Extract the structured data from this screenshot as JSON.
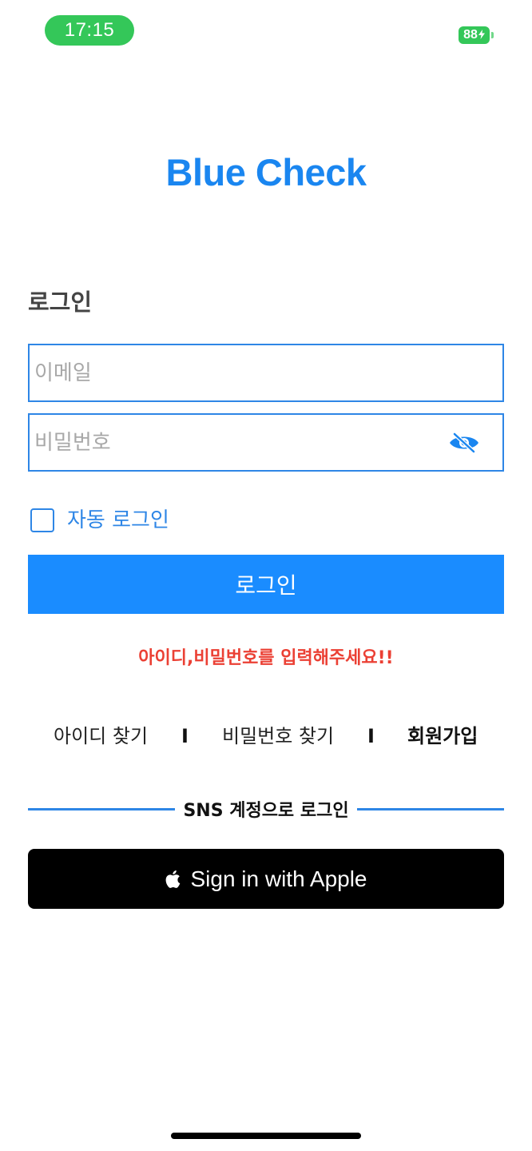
{
  "status_bar": {
    "time": "17:15",
    "battery_level": "88",
    "battery_charging": true,
    "accent_color": "#34c759"
  },
  "brand": {
    "name": "Blue Check",
    "color": "#1a86f0"
  },
  "login": {
    "title": "로그인",
    "email_placeholder": "이메일",
    "password_placeholder": "비밀번호",
    "password_toggle_icon": "eye-slash-icon",
    "auto_login_label": "자동 로그인",
    "auto_login_checked": false,
    "submit_label": "로그인",
    "error_message": "아이디,비밀번호를 입력해주세요!!",
    "error_color": "#eb4034"
  },
  "links": {
    "find_id": "아이디 찾기",
    "separator": "I",
    "find_password": "비밀번호 찾기",
    "signup": "회원가입"
  },
  "sns": {
    "divider_label": "SNS 계정으로 로그인",
    "apple_label": "Sign in with Apple",
    "apple_icon": "apple-logo-icon"
  }
}
